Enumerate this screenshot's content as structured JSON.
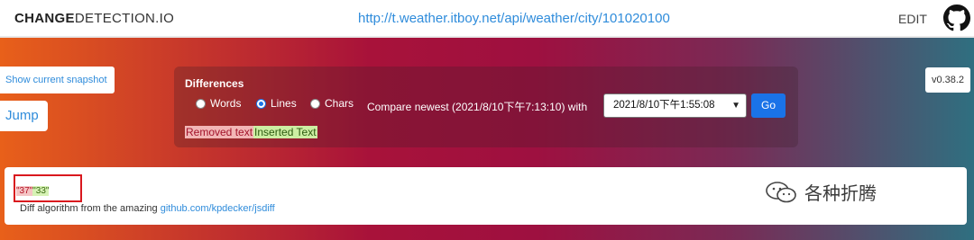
{
  "header": {
    "brand_bold": "CHANGE",
    "brand_rest": "DETECTION.IO",
    "watch_url": "http://t.weather.itboy.net/api/weather/city/101020100",
    "edit_label": "EDIT",
    "github_icon": "github-icon"
  },
  "left_buttons": {
    "snapshot_label": "Show current snapshot",
    "jump_label": "Jump"
  },
  "version": "v0.38.2",
  "diff_options": {
    "title": "Differences",
    "modes": [
      {
        "label": "Words",
        "checked": false
      },
      {
        "label": "Lines",
        "checked": true
      },
      {
        "label": "Chars",
        "checked": false
      }
    ],
    "compare_text": "Compare newest (2021/8/10下午7:13:10) with",
    "selected_date": "2021/8/10下午1:55:08",
    "go_label": "Go",
    "legend_removed": "Removed text",
    "legend_inserted": "Inserted Text"
  },
  "result": {
    "removed_value": "\"37\"",
    "inserted_value": "\"33\"",
    "algo_prefix": "Diff algorithm from the amazing ",
    "algo_link": "github.com/kpdecker/jsdiff"
  },
  "watermark": {
    "text": "各种折腾",
    "icon": "wechat-icon"
  },
  "colors": {
    "accent_blue": "#1a73e8",
    "link_blue": "#2f8cdb",
    "highlight_red": "#d9181e"
  }
}
